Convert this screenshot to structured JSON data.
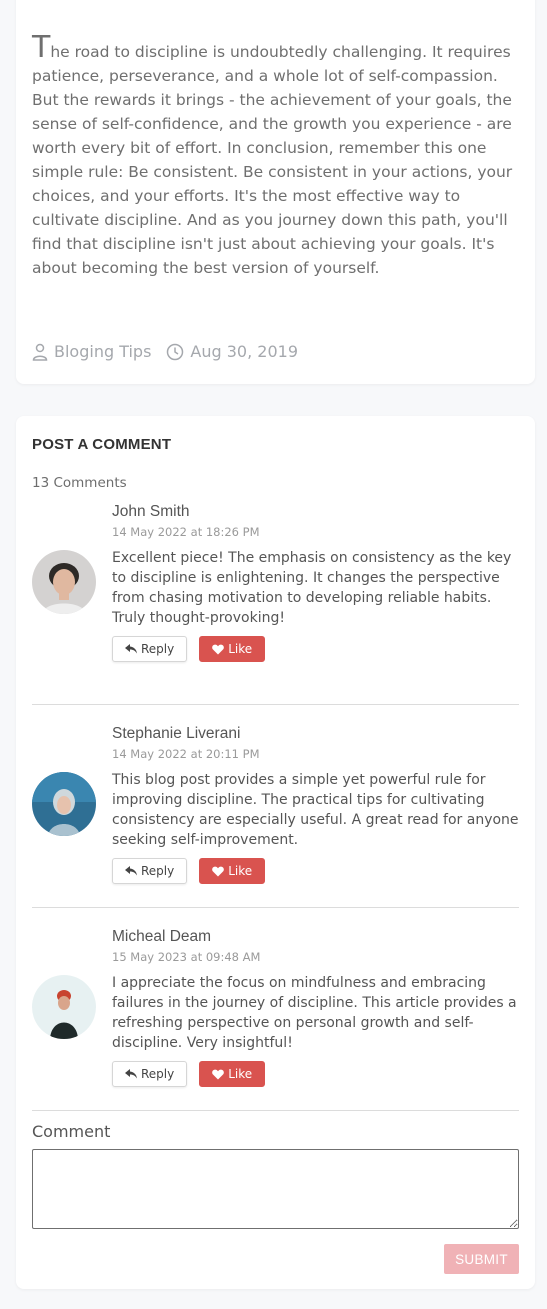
{
  "article": {
    "dropcap": "T",
    "text": "he road to discipline is undoubtedly challenging. It requires patience, perseverance, and a whole lot of self-compassion. But the rewards it brings - the achievement of your goals, the sense of self-confidence, and the growth you experience - are worth every bit of effort. In conclusion, remember this one simple rule: Be consistent. Be consistent in your actions, your choices, and your efforts. It's the most effective way to cultivate discipline. And as you journey down this path, you'll find that discipline isn't just about achieving your goals. It's about becoming the best version of yourself.",
    "category": "Bloging Tips",
    "date": "Aug 30, 2019"
  },
  "comments_section": {
    "title": "POST A COMMENT",
    "count": "13 Comments",
    "reply_label": "Reply",
    "like_label": "Like",
    "comments": [
      {
        "name": "John Smith",
        "date": "14 May 2022 at 18:26 PM",
        "text": "Excellent piece! The emphasis on consistency as the key to discipline is enlightening. It changes the perspective from chasing motivation to developing reliable habits. Truly thought-provoking!"
      },
      {
        "name": "Stephanie Liverani",
        "date": "14 May 2022 at 20:11 PM",
        "text": "This blog post provides a simple yet powerful rule for improving discipline. The practical tips for cultivating consistency are especially useful. A great read for anyone seeking self-improvement."
      },
      {
        "name": "Micheal Deam",
        "date": "15 May 2023 at 09:48 AM",
        "text": "I appreciate the focus on mindfulness and embracing failures in the journey of discipline. This article provides a refreshing perspective on personal growth and self-discipline. Very insightful!"
      }
    ],
    "form": {
      "label": "Comment",
      "placeholder": "",
      "submit_label": "SUBMIT"
    }
  },
  "colors": {
    "like_button": "#d9534f",
    "submit_button": "#f0b2b6",
    "background": "#f7f8fa"
  },
  "icons": {
    "category": "user-icon",
    "date": "clock-icon",
    "reply": "reply-arrow-icon",
    "like": "heart-icon"
  }
}
